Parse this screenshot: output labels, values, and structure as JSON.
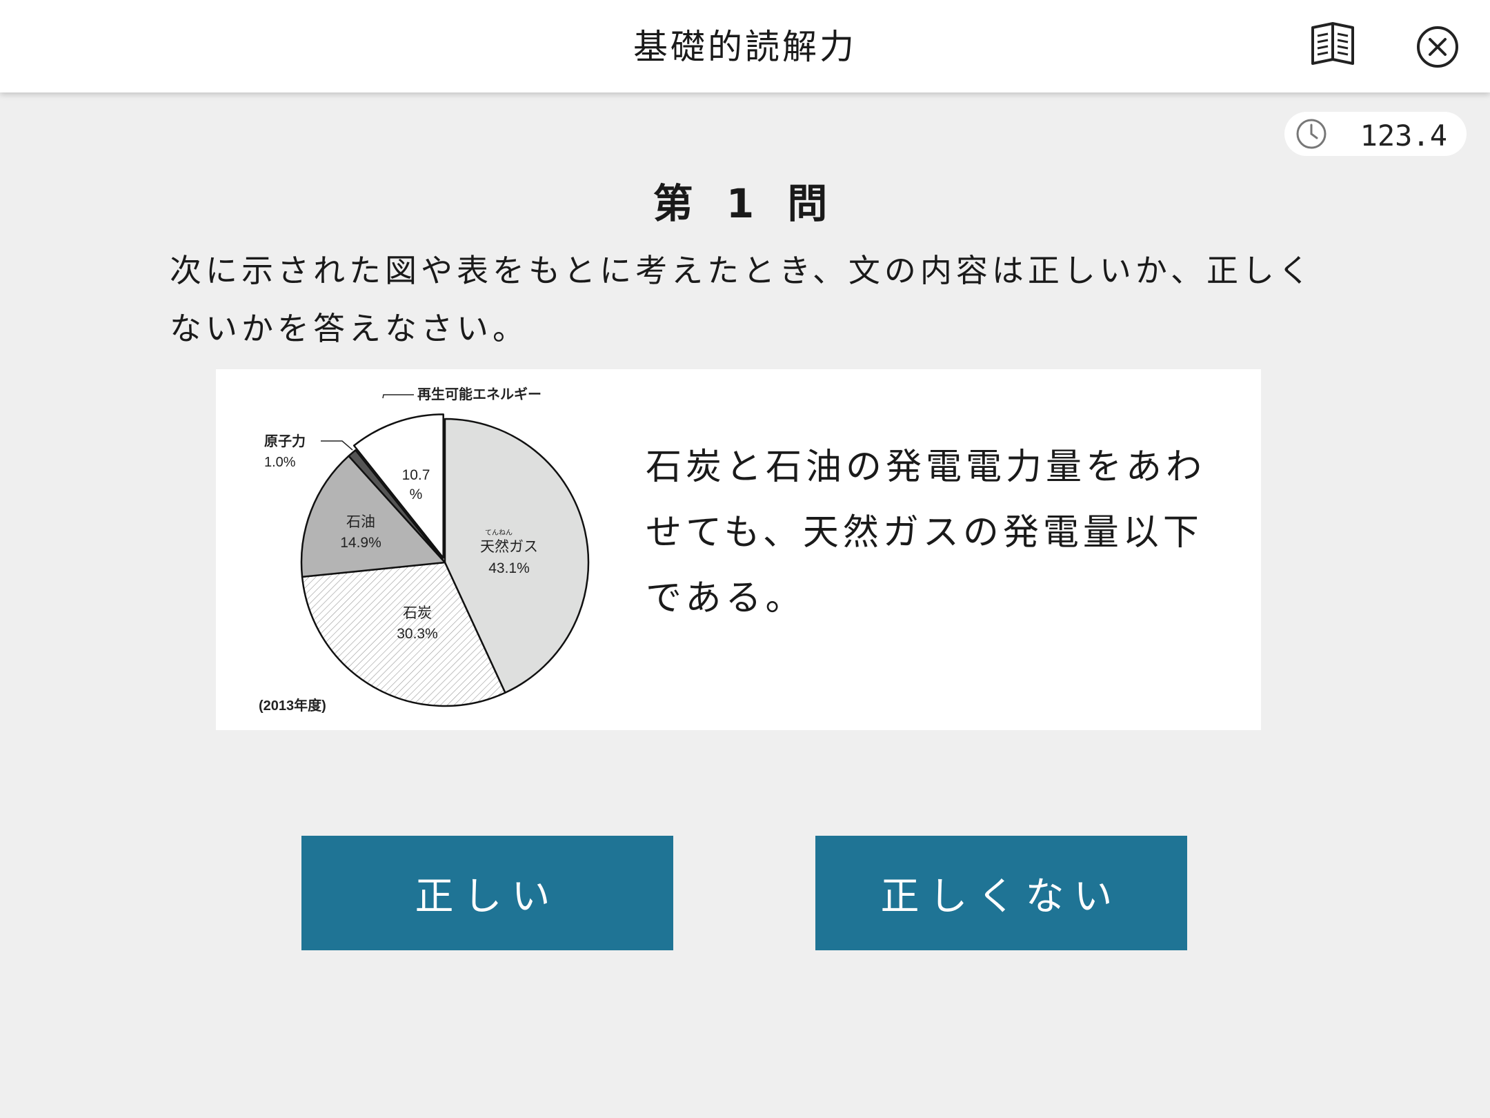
{
  "header": {
    "title": "基礎的読解力",
    "book_icon": "book-icon",
    "close_icon": "close-icon"
  },
  "timer": {
    "icon": "clock-icon",
    "value": "123.4"
  },
  "question": {
    "title": "第 1 問",
    "instruction": "次に示された図や表をもとに考えたとき、文の内容は正しいか、正しくないかを答えなさい。",
    "statement": "石炭と石油の発電電力量をあわせても、天然ガスの発電量以下である。"
  },
  "chart_data": {
    "type": "pie",
    "note": "(2013年度)",
    "slices": [
      {
        "label": "天然ガス",
        "ruby": "てんねん",
        "value": 43.1,
        "display": "43.1%",
        "fill": "#dedfde"
      },
      {
        "label": "石炭",
        "value": 30.3,
        "display": "30.3%",
        "fill": "hatched"
      },
      {
        "label": "石油",
        "value": 14.9,
        "display": "14.9%",
        "fill": "#b4b4b4"
      },
      {
        "label": "原子力",
        "value": 1.0,
        "display": "1.0%",
        "fill": "#555555"
      },
      {
        "label": "再生可能エネルギー",
        "value": 10.7,
        "display_line1": "10.7",
        "display_line2": "%",
        "fill": "#ffffff"
      }
    ]
  },
  "answers": {
    "true_label": "正しい",
    "false_label": "正しくない"
  },
  "colors": {
    "background": "#efefef",
    "header": "#ffffff",
    "button": "#1f7495",
    "button_text": "#ffffff"
  }
}
